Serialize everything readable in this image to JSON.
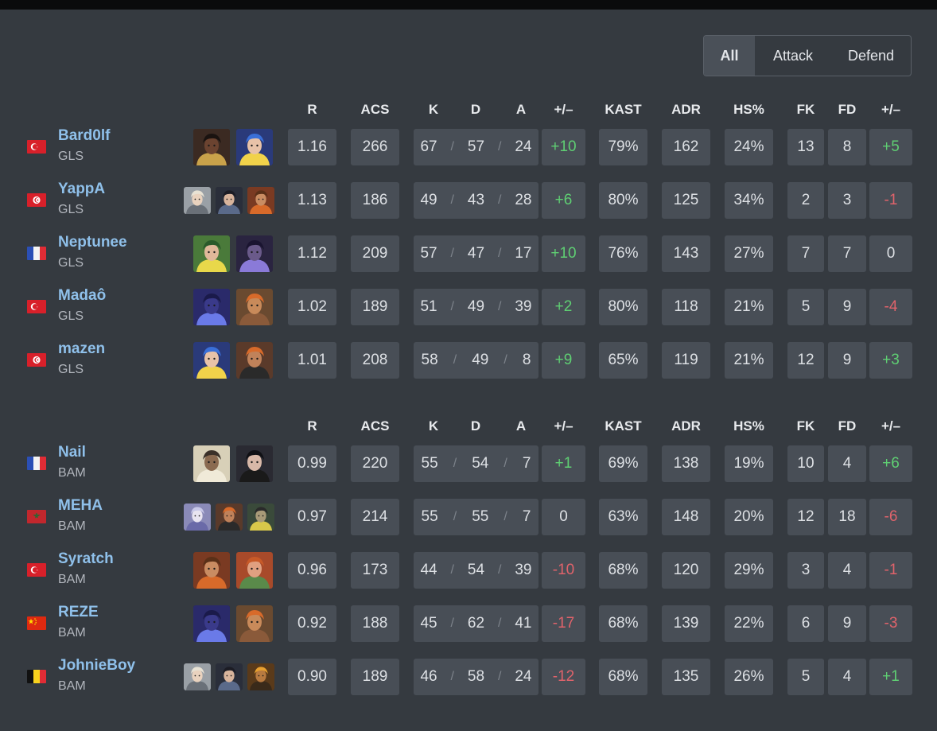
{
  "tabs": [
    "All",
    "Attack",
    "Defend"
  ],
  "active_tab": "All",
  "headers": [
    "R",
    "ACS",
    "K",
    "D",
    "A",
    "+/–",
    "KAST",
    "ADR",
    "HS%",
    "FK",
    "FD",
    "+/–"
  ],
  "teams": [
    {
      "players": [
        {
          "name": "Bard0lf",
          "team": "GLS",
          "flag": "tr",
          "agents": [
            "agent-1",
            "agent-2"
          ],
          "r": "1.16",
          "acs": "266",
          "k": "67",
          "d": "57",
          "a": "24",
          "pm": "+10",
          "kast": "79%",
          "adr": "162",
          "hs": "24%",
          "fk": "13",
          "fd": "8",
          "fpm": "+5"
        },
        {
          "name": "YappA",
          "team": "GLS",
          "flag": "tn",
          "agents": [
            "agent-3",
            "agent-4",
            "agent-5"
          ],
          "r": "1.13",
          "acs": "186",
          "k": "49",
          "d": "43",
          "a": "28",
          "pm": "+6",
          "kast": "80%",
          "adr": "125",
          "hs": "34%",
          "fk": "2",
          "fd": "3",
          "fpm": "-1"
        },
        {
          "name": "Neptunee",
          "team": "GLS",
          "flag": "fr",
          "agents": [
            "agent-6",
            "agent-7"
          ],
          "r": "1.12",
          "acs": "209",
          "k": "57",
          "d": "47",
          "a": "17",
          "pm": "+10",
          "kast": "76%",
          "adr": "143",
          "hs": "27%",
          "fk": "7",
          "fd": "7",
          "fpm": "0"
        },
        {
          "name": "Madaô",
          "team": "GLS",
          "flag": "tr",
          "agents": [
            "agent-8",
            "agent-9"
          ],
          "r": "1.02",
          "acs": "189",
          "k": "51",
          "d": "49",
          "a": "39",
          "pm": "+2",
          "kast": "80%",
          "adr": "118",
          "hs": "21%",
          "fk": "5",
          "fd": "9",
          "fpm": "-4"
        },
        {
          "name": "mazen",
          "team": "GLS",
          "flag": "tn",
          "agents": [
            "agent-2",
            "agent-10"
          ],
          "r": "1.01",
          "acs": "208",
          "k": "58",
          "d": "49",
          "a": "8",
          "pm": "+9",
          "kast": "65%",
          "adr": "119",
          "hs": "21%",
          "fk": "12",
          "fd": "9",
          "fpm": "+3"
        }
      ]
    },
    {
      "players": [
        {
          "name": "Nail",
          "team": "BAM",
          "flag": "fr",
          "agents": [
            "agent-11",
            "agent-12"
          ],
          "r": "0.99",
          "acs": "220",
          "k": "55",
          "d": "54",
          "a": "7",
          "pm": "+1",
          "kast": "69%",
          "adr": "138",
          "hs": "19%",
          "fk": "10",
          "fd": "4",
          "fpm": "+6"
        },
        {
          "name": "MEHA",
          "team": "BAM",
          "flag": "ma",
          "agents": [
            "agent-13",
            "agent-10",
            "agent-14"
          ],
          "r": "0.97",
          "acs": "214",
          "k": "55",
          "d": "55",
          "a": "7",
          "pm": "0",
          "kast": "63%",
          "adr": "148",
          "hs": "20%",
          "fk": "12",
          "fd": "18",
          "fpm": "-6"
        },
        {
          "name": "Syratch",
          "team": "BAM",
          "flag": "tr",
          "agents": [
            "agent-5",
            "agent-15"
          ],
          "r": "0.96",
          "acs": "173",
          "k": "44",
          "d": "54",
          "a": "39",
          "pm": "-10",
          "kast": "68%",
          "adr": "120",
          "hs": "29%",
          "fk": "3",
          "fd": "4",
          "fpm": "-1"
        },
        {
          "name": "REZE",
          "team": "BAM",
          "flag": "cn",
          "agents": [
            "agent-8",
            "agent-9"
          ],
          "r": "0.92",
          "acs": "188",
          "k": "45",
          "d": "62",
          "a": "41",
          "pm": "-17",
          "kast": "68%",
          "adr": "139",
          "hs": "22%",
          "fk": "6",
          "fd": "9",
          "fpm": "-3"
        },
        {
          "name": "JohnieBoy",
          "team": "BAM",
          "flag": "be",
          "agents": [
            "agent-3",
            "agent-4",
            "agent-16"
          ],
          "r": "0.90",
          "acs": "189",
          "k": "46",
          "d": "58",
          "a": "24",
          "pm": "-12",
          "kast": "68%",
          "adr": "135",
          "hs": "26%",
          "fk": "5",
          "fd": "4",
          "fpm": "+1"
        }
      ]
    }
  ],
  "colors": {
    "background": "#353a40",
    "cell": "#484e56",
    "player_name": "#8fc0ea",
    "positive": "#5fcf73",
    "negative": "#e0636b"
  }
}
